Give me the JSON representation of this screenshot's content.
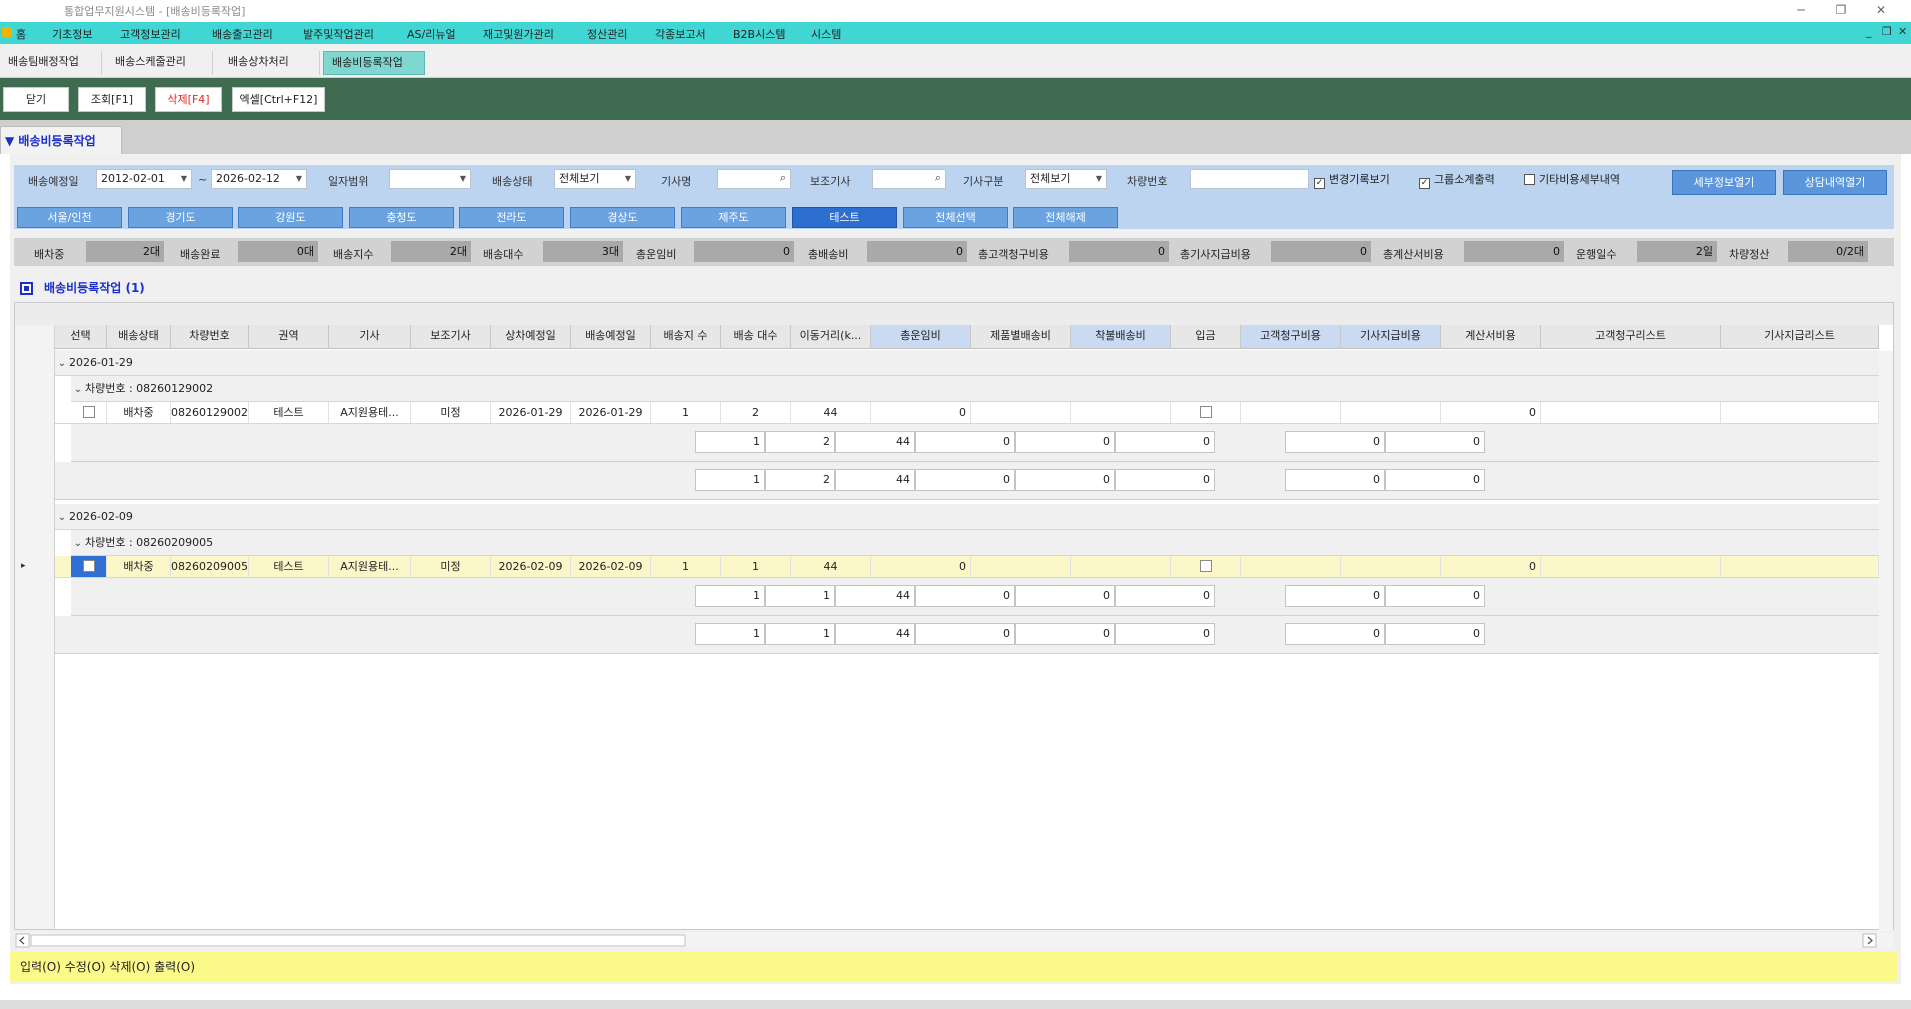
{
  "window": {
    "title": "통합업무지원시스템 - [배송비등록작업]",
    "controls": [
      "─",
      "❐",
      "✕"
    ]
  },
  "menu": {
    "items": [
      "홈",
      "기초정보",
      "고객정보관리",
      "배송출고관리",
      "발주및작업관리",
      "AS/리뉴얼",
      "재고및원가관리",
      "정산관리",
      "각종보고서",
      "B2B시스템",
      "시스템"
    ],
    "mdi_controls": [
      "_",
      "❐",
      "✕"
    ]
  },
  "tabs": {
    "items": [
      "배송팀배정작업",
      "배송스케줄관리",
      "배송상차처리",
      "배송비등록작업"
    ],
    "active_index": 3
  },
  "toolbar": {
    "close": "닫기",
    "search": "조회[F1]",
    "delete": "삭제[F4]",
    "excel": "엑셀[Ctrl+F12]"
  },
  "section": {
    "title": "▼ 배송비등록작업"
  },
  "filters": {
    "delivery_date_label": "배송예정일",
    "date_from": "2012-02-01",
    "date_sep": "~",
    "date_to": "2026-02-12",
    "date_range_label": "일자범위",
    "date_range_value": "",
    "delivery_status_label": "배송상태",
    "delivery_status_value": "전체보기",
    "driver_name_label": "기사명",
    "driver_name_value": "",
    "assistant_label": "보조기사",
    "assistant_value": "",
    "driver_type_label": "기사구분",
    "driver_type_value": "전체보기",
    "vehicle_no_label": "차량번호",
    "vehicle_no_value": "",
    "chk_change_history": "변경기록보기",
    "chk_group_subtotal": "그룹소계출력",
    "chk_other_cost": "기타비용세부내역",
    "btn_detail_info": "세부정보열기",
    "btn_consult_history": "상담내역열기"
  },
  "regions": {
    "items": [
      "서울/인천",
      "경기도",
      "강원도",
      "충청도",
      "전라도",
      "경상도",
      "제주도",
      "테스트",
      "전체선택",
      "전체해제"
    ],
    "selected_index": 7
  },
  "stats": [
    {
      "label": "배차중",
      "value": "2대"
    },
    {
      "label": "배송완료",
      "value": "0대"
    },
    {
      "label": "배송지수",
      "value": "2대"
    },
    {
      "label": "배송대수",
      "value": "3대"
    },
    {
      "label": "총운임비",
      "value": "0"
    },
    {
      "label": "총배송비",
      "value": "0"
    },
    {
      "label": "총고객청구비용",
      "value": "0"
    },
    {
      "label": "총기사지급비용",
      "value": "0"
    },
    {
      "label": "총계산서비용",
      "value": "0"
    },
    {
      "label": "운행일수",
      "value": "2일"
    },
    {
      "label": "차량정산",
      "value": "0/2대"
    }
  ],
  "grid": {
    "title": "배송비등록작업 (1)",
    "columns": [
      "선택",
      "배송상태",
      "차량번호",
      "권역",
      "기사",
      "보조기사",
      "상차예정일",
      "배송예정일",
      "배송지 수",
      "배송 대수",
      "이동거리(k...",
      "총운임비",
      "제품별배송비",
      "착불배송비",
      "입금",
      "고객청구비용",
      "기사지급비용",
      "계산서비용",
      "고객청구리스트",
      "기사지급리스트"
    ],
    "groups": [
      {
        "date": "2026-01-29",
        "vehicle_group": "차량번호 : 08260129002",
        "row": {
          "status": "배차중",
          "vehicle": "08260129002",
          "region": "테스트",
          "driver": "A지원용테...",
          "assistant": "미정",
          "load_date": "2026-01-29",
          "delivery_date": "2026-01-29",
          "stops": "1",
          "trucks": "2",
          "distance": "44",
          "freight": "0",
          "invoice": "0"
        },
        "subtotal": {
          "stops": "1",
          "trucks": "2",
          "distance": "44",
          "freight": "0",
          "product_fee": "0",
          "cod_fee": "0",
          "customer_charge": "0",
          "driver_pay": "0"
        },
        "total": {
          "stops": "1",
          "trucks": "2",
          "distance": "44",
          "freight": "0",
          "product_fee": "0",
          "cod_fee": "0",
          "customer_charge": "0",
          "driver_pay": "0"
        }
      },
      {
        "date": "2026-02-09",
        "vehicle_group": "차량번호 : 08260209005",
        "row": {
          "status": "배차중",
          "vehicle": "08260209005",
          "region": "테스트",
          "driver": "A지원용테...",
          "assistant": "미정",
          "load_date": "2026-02-09",
          "delivery_date": "2026-02-09",
          "stops": "1",
          "trucks": "1",
          "distance": "44",
          "freight": "0",
          "invoice": "0"
        },
        "subtotal": {
          "stops": "1",
          "trucks": "1",
          "distance": "44",
          "freight": "0",
          "product_fee": "0",
          "cod_fee": "0",
          "customer_charge": "0",
          "driver_pay": "0"
        },
        "total": {
          "stops": "1",
          "trucks": "1",
          "distance": "44",
          "freight": "0",
          "product_fee": "0",
          "cod_fee": "0",
          "customer_charge": "0",
          "driver_pay": "0"
        }
      }
    ]
  },
  "statusbar": {
    "text": "입력(O) 수정(O) 삭제(O) 출력(O)"
  },
  "colors": {
    "menubar": "#40d6d3",
    "toolbar": "#3f6b51",
    "filter_bg": "#bcd4f0",
    "button_blue": "#5b96dc",
    "highlight_row": "#fbf7c8",
    "statusbar": "#fbf98a"
  }
}
